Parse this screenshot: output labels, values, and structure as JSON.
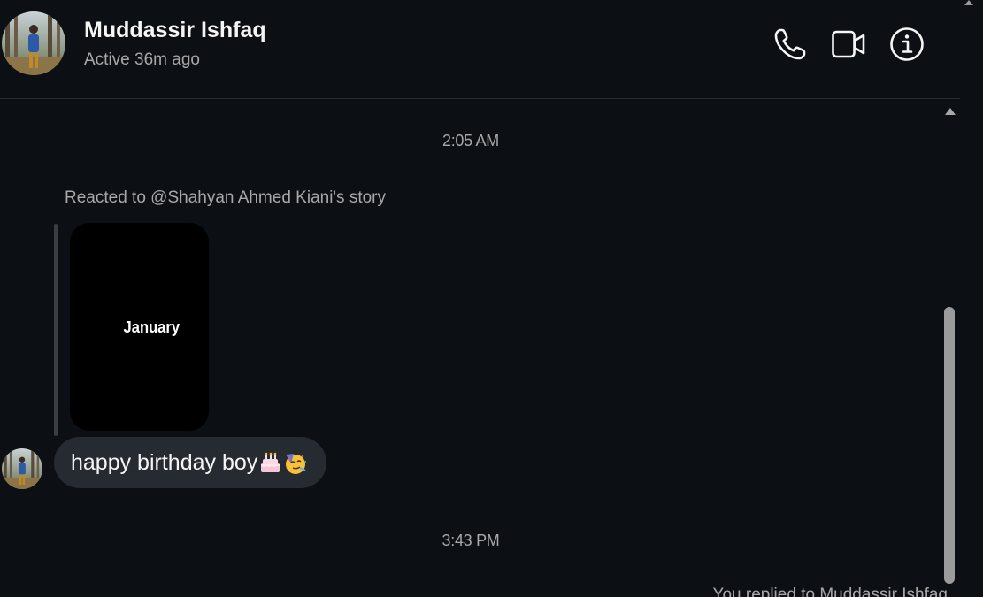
{
  "header": {
    "contact_name": "Muddassir Ishfaq",
    "status": "Active 36m ago",
    "avatar": "contact-avatar-photo"
  },
  "actions": {
    "call_icon": "phone-icon",
    "video_icon": "video-camera-icon",
    "info_icon": "info-icon"
  },
  "chat": {
    "timestamp_1": "2:05 AM",
    "story_reaction_label": "Reacted to @Shahyan Ahmed Kiani's story",
    "story_text": "January",
    "message_text": "happy birthday boy",
    "message_emojis": [
      "birthday-cake-emoji",
      "partying-face-emoji"
    ],
    "timestamp_2": "3:43 PM",
    "reply_label": "You replied to Muddassir Ishfaq"
  },
  "colors": {
    "background": "#0c0f14",
    "bubble": "#262a31",
    "secondary_text": "#a8a8a8",
    "primary_text": "#f5f5f5"
  }
}
